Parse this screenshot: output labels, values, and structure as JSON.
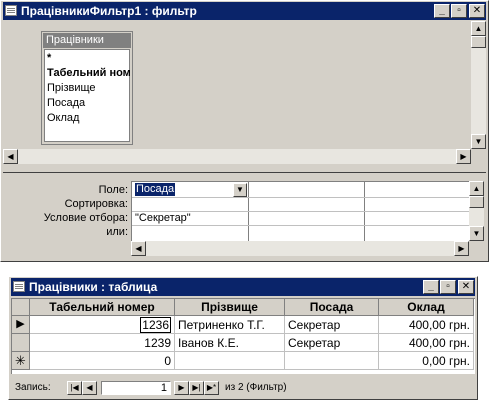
{
  "filter_window": {
    "title": "ПрацівникиФильтр1 : фильтр",
    "field_list": {
      "title": "Працівники",
      "fields": [
        "*",
        "Табельний номер",
        "Прізвище",
        "Посада",
        "Оклад"
      ]
    },
    "grid": {
      "row_labels": {
        "field": "Поле:",
        "sort": "Сортировка:",
        "criteria": "Условие отбора:",
        "or": "или:"
      },
      "field_value": "Посада",
      "criteria_value": "\"Секретар\""
    }
  },
  "table_window": {
    "title": "Працівники : таблица",
    "columns": [
      "Табельний номер",
      "Прізвище",
      "Посада",
      "Оклад"
    ],
    "rows": [
      {
        "id": "1236",
        "surname": "Петриненко Т.Г.",
        "position": "Секретар",
        "salary": "400,00 грн."
      },
      {
        "id": "1239",
        "surname": "Іванов К.Е.",
        "position": "Секретар",
        "salary": "400,00 грн."
      },
      {
        "id": "0",
        "surname": "",
        "position": "",
        "salary": "0,00 грн."
      }
    ],
    "navigation": {
      "label": "Запись:",
      "current": "1",
      "total_text": "из 2 (Фильтр)"
    }
  },
  "colors": {
    "title_active": "#0a246a",
    "face": "#d4d0c8"
  },
  "icons": [
    "window-icon",
    "minimize-icon",
    "restore-icon",
    "close-icon",
    "dropdown-arrow-icon",
    "row-pointer-icon",
    "new-record-icon"
  ]
}
